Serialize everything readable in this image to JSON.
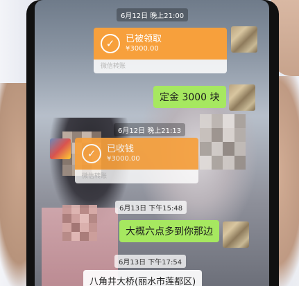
{
  "messages": {
    "ts1": "6月12日 晚上21:00",
    "transfer1": {
      "title": "已被领取",
      "amount": "¥3000.00",
      "footer": "微信转账"
    },
    "bubble1": "定金 3000 块",
    "ts2": "6月12日 晚上21:13",
    "transfer2": {
      "title": "已收钱",
      "amount": "¥3000.00",
      "footer": "微信转账"
    },
    "ts3": "6月13日 下午15:48",
    "bubble2": "大概六点多到你那边",
    "ts4": "6月13日 下午17:54",
    "bubble3": "八角井大桥(丽水市莲都区)"
  },
  "icons": {
    "check": "check-circle-icon"
  },
  "colors": {
    "transfer_orange": "#f7a03c",
    "bubble_green": "#a6e860"
  }
}
